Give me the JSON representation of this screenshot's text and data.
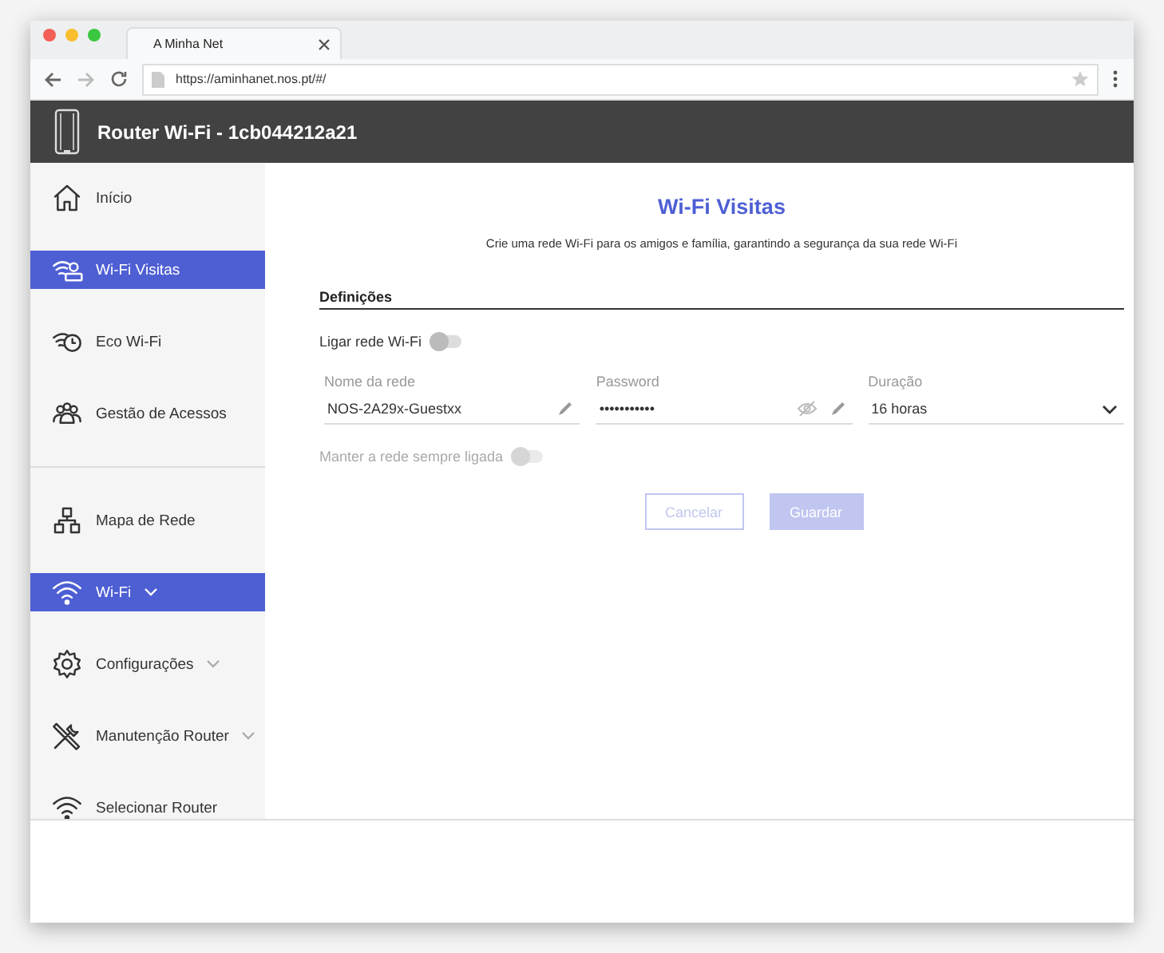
{
  "browser": {
    "tab_title": "A Minha Net",
    "url": "https://aminhanet.nos.pt/#/"
  },
  "header": {
    "title": "Router Wi-Fi - 1cb044212a21"
  },
  "sidebar": {
    "groups": [
      [
        {
          "label": "Início",
          "kind": "home",
          "selected": false,
          "caret": false
        },
        {
          "label": "Wi-Fi Visitas",
          "kind": "guest",
          "selected": true,
          "caret": false
        },
        {
          "label": "Eco Wi-Fi",
          "kind": "eco",
          "selected": false,
          "caret": false
        },
        {
          "label": "Gestão de Acessos",
          "kind": "people",
          "selected": false,
          "caret": false
        }
      ],
      [
        {
          "label": "Mapa de Rede",
          "kind": "map",
          "selected": false,
          "caret": false
        },
        {
          "label": "Wi-Fi",
          "kind": "wifi",
          "selected": true,
          "caret": true
        },
        {
          "label": "Configurações",
          "kind": "gear",
          "selected": false,
          "caret": true
        },
        {
          "label": "Manutenção Router",
          "kind": "tools",
          "selected": false,
          "caret": true
        },
        {
          "label": "Selecionar Router",
          "kind": "wifi",
          "selected": false,
          "caret": false
        }
      ]
    ]
  },
  "main": {
    "title": "Wi-Fi Visitas",
    "subtitle": "Crie uma rede Wi-Fi para os amigos e família, garantindo a segurança da sua rede Wi-Fi",
    "section": "Definições",
    "toggle": {
      "label": "Ligar rede Wi-Fi",
      "on": false,
      "disabled": false
    },
    "fields": [
      {
        "kind": "text",
        "label": "Nome da rede",
        "value": "NOS-2A29x-Guestxx"
      },
      {
        "kind": "password",
        "label": "Password",
        "value": "•••••••••••"
      },
      {
        "kind": "select",
        "label": "Duração",
        "value": "16 horas"
      }
    ],
    "toggle2": {
      "label": "Manter a rede sempre ligada",
      "on": false,
      "disabled": true
    },
    "buttons": [
      {
        "kind": "secondary",
        "label": "Cancelar",
        "disabled": true
      },
      {
        "kind": "primary",
        "label": "Guardar",
        "disabled": true
      }
    ]
  }
}
